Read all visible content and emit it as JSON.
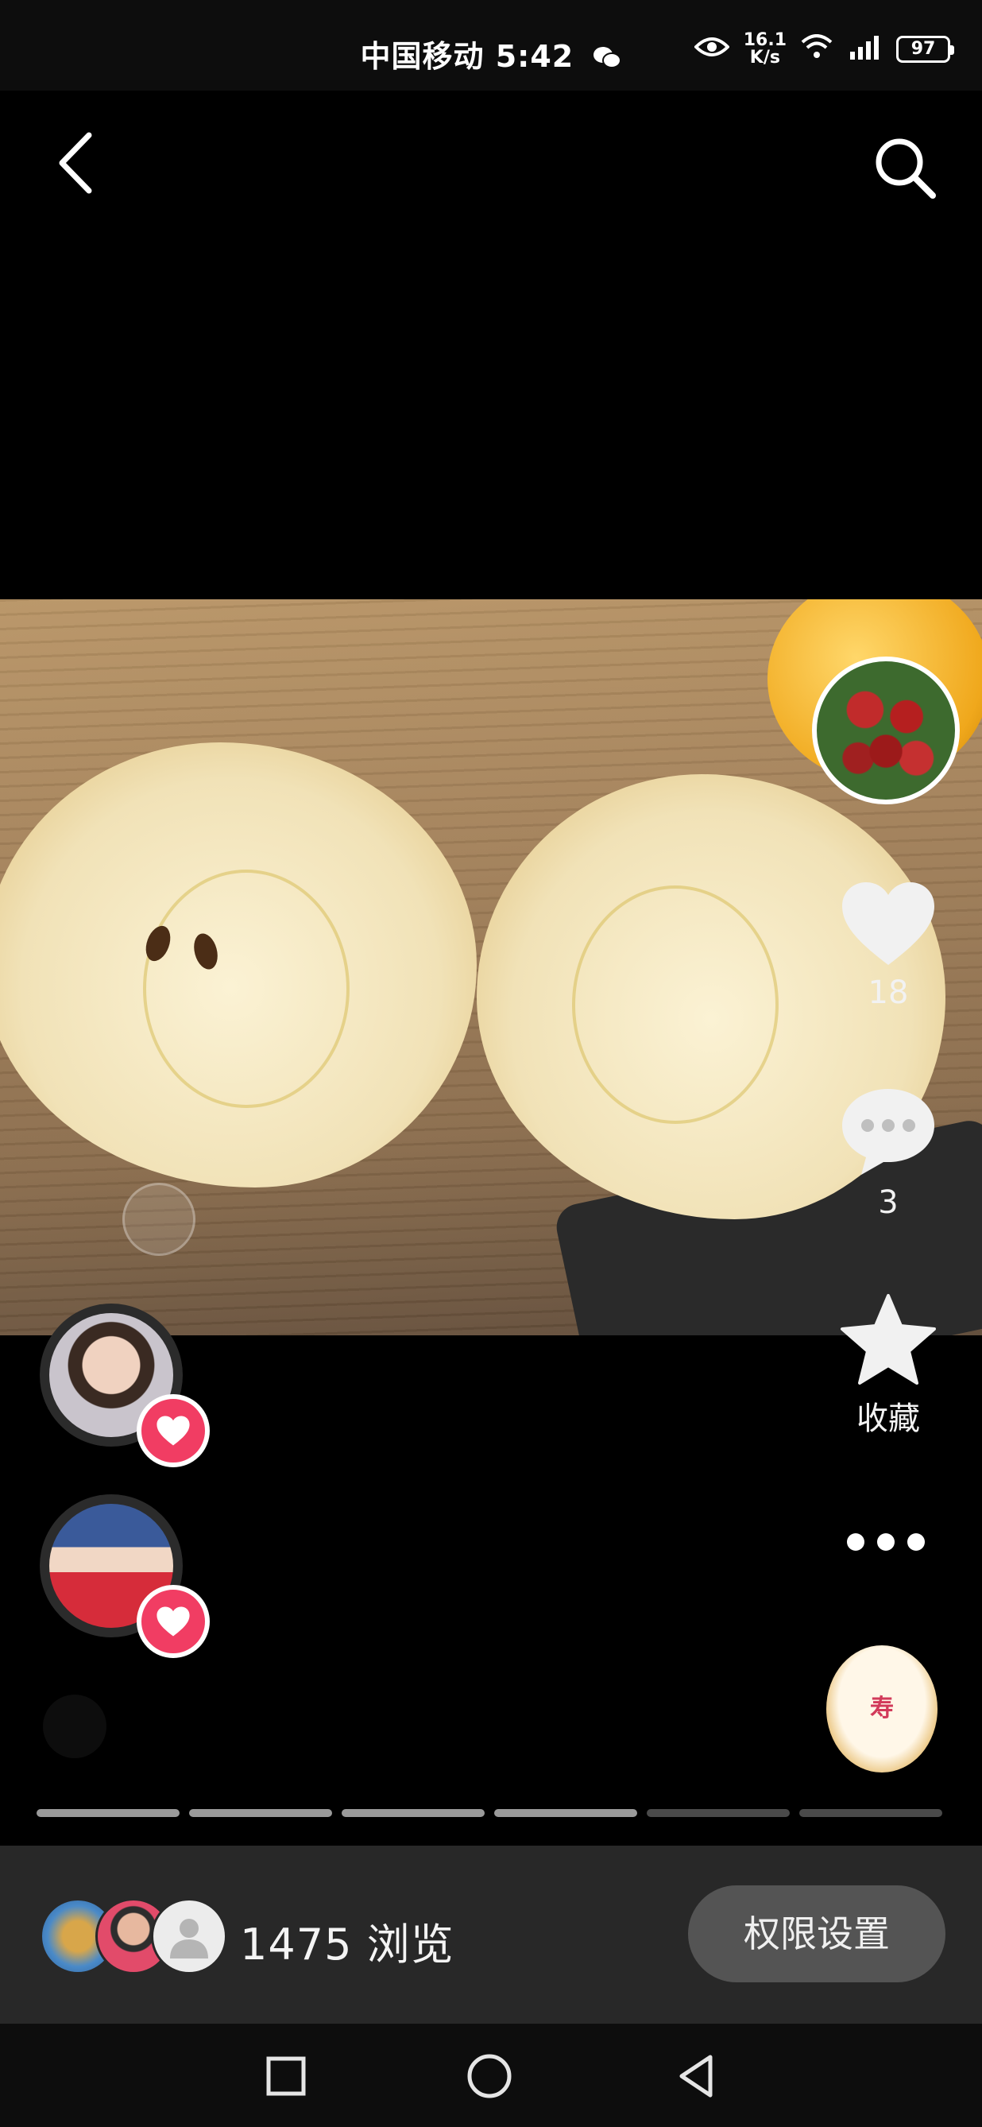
{
  "status_bar": {
    "carrier_time": "中国移动 5:42",
    "net_speed_value": "16.1",
    "net_speed_unit": "K/s",
    "battery": "97"
  },
  "post": {
    "like_count": "18",
    "comment_count": "3",
    "favorite_label": "收藏",
    "sticker_text": "寿"
  },
  "progress": {
    "segments_total": 6,
    "segments_done": 4
  },
  "bottom_bar": {
    "view_count": "1475 浏览",
    "permission_button": "权限设置"
  },
  "colors": {
    "accent_heart": "#f13d63",
    "bottom_bar_bg": "#282828",
    "button_bg": "#545454"
  }
}
